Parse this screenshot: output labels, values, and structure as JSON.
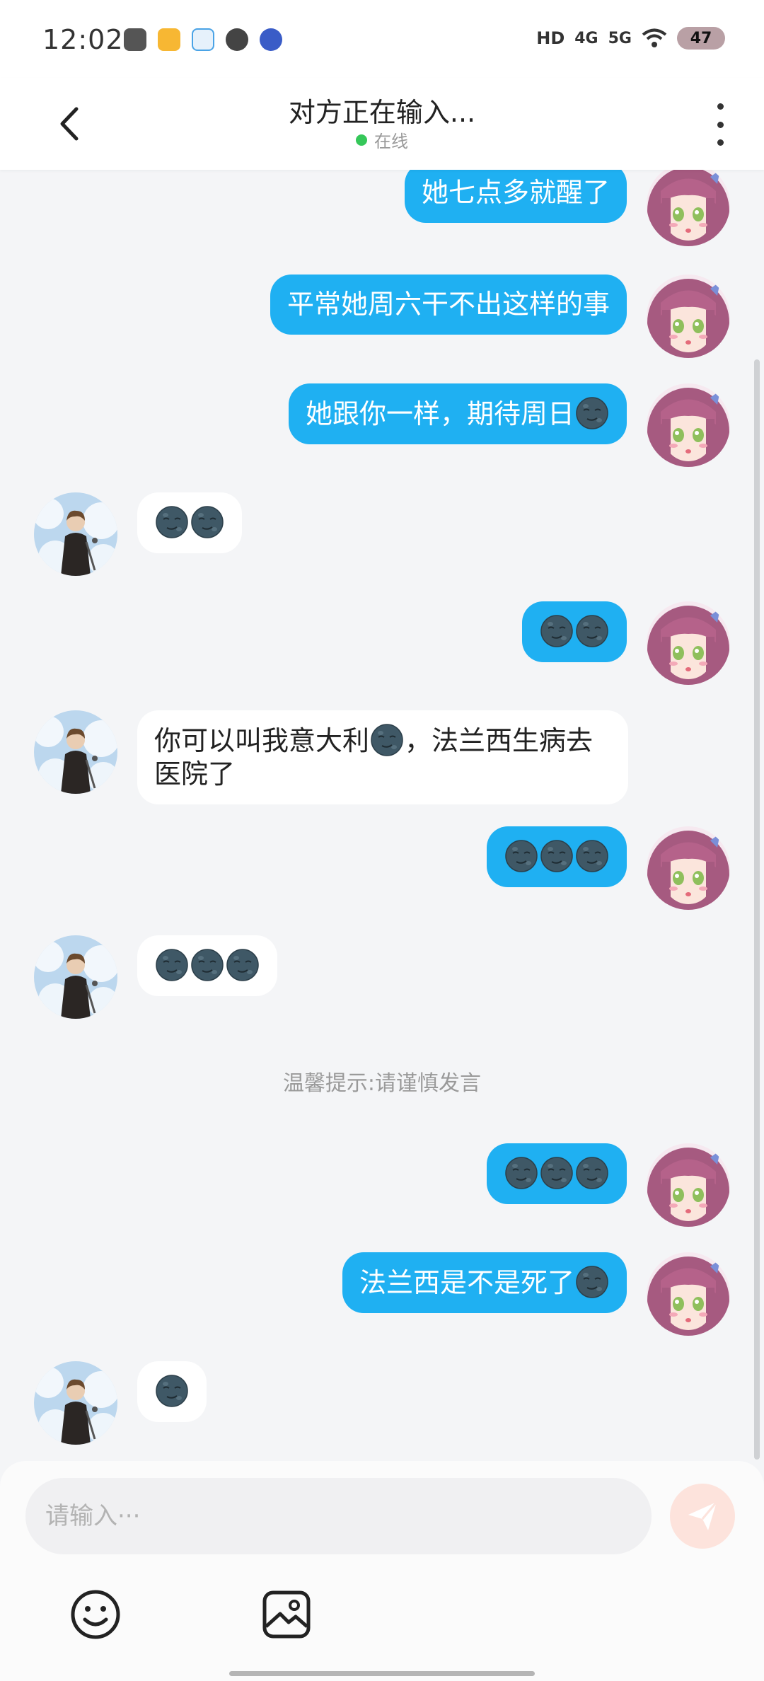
{
  "status_bar": {
    "time": "12:02",
    "network_hd": "HD",
    "network_4g": "4G",
    "network_5g": "5G",
    "battery": "47"
  },
  "header": {
    "title": "对方正在输入...",
    "status": "在线"
  },
  "messages": [
    {
      "from": "me",
      "text": "她七点多就醒了"
    },
    {
      "from": "me",
      "text": "平常她周六干不出这样的事"
    },
    {
      "from": "me",
      "text": "她跟你一样，期待周日",
      "emoji_after": 1
    },
    {
      "from": "them",
      "text": "",
      "emoji_only": 2
    },
    {
      "from": "me",
      "text": "",
      "emoji_only": 2
    },
    {
      "from": "them",
      "text_a": "你可以叫我意大利",
      "text_b": "，法兰西生病去医院了"
    },
    {
      "from": "me",
      "text": "",
      "emoji_only": 3
    },
    {
      "from": "them",
      "text": "",
      "emoji_only": 3
    },
    {
      "from": "me",
      "text": "",
      "emoji_only": 3
    },
    {
      "from": "me",
      "text": "法兰西是不是死了",
      "emoji_after": 1
    },
    {
      "from": "them",
      "text": "",
      "emoji_only": 1
    }
  ],
  "notice": "温馨提示:请谨慎发言",
  "composer": {
    "placeholder": "请输入···"
  },
  "icons": {
    "back": "chevron-left-icon",
    "more": "more-vertical-icon",
    "send": "send-icon",
    "emoji": "smiley-icon",
    "image": "image-icon",
    "moon": "new-moon-face-emoji"
  },
  "colors": {
    "my_bubble": "#1fb0f2",
    "their_bubble": "#ffffff",
    "online_dot": "#35c759",
    "send_button": "#fde3dc"
  }
}
